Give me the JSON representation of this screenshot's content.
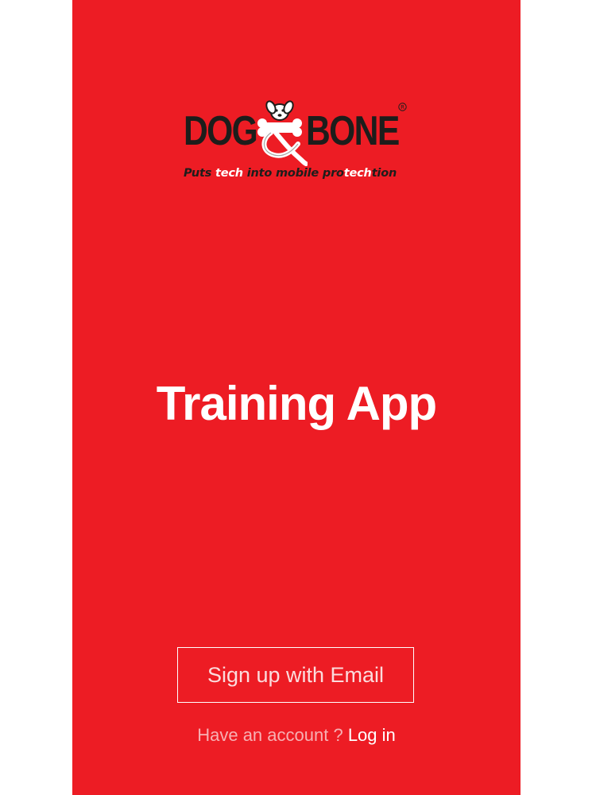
{
  "brand": {
    "name_left": "DOG",
    "name_right": "BONE",
    "tagline_parts": [
      {
        "text": "Puts ",
        "highlight": false
      },
      {
        "text": "tech",
        "highlight": true
      },
      {
        "text": " into mobile pro",
        "highlight": false
      },
      {
        "text": "tech",
        "highlight": true
      },
      {
        "text": "tion",
        "highlight": false
      }
    ],
    "logo_icon": "dog-ampersand-bone-mark",
    "registered_icon": "registered-trademark-icon"
  },
  "main": {
    "title": "Training App"
  },
  "auth": {
    "signup_label": "Sign up with Email",
    "account_prompt": "Have an account ?",
    "login_label": "Log in"
  },
  "colors": {
    "background": "#ed1c24",
    "text": "#ffffff",
    "logo_dark": "#1d1d1b"
  }
}
